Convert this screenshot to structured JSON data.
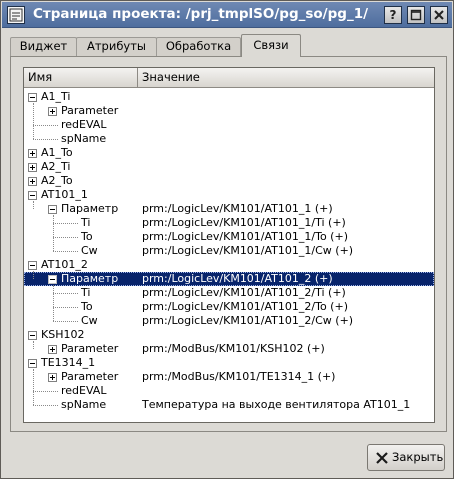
{
  "window": {
    "title": "Страница проекта: /prj_tmplSO/pg_so/pg_1/",
    "help_label": "?",
    "buttons": [
      "help-button",
      "maximize-button",
      "close-window-button"
    ]
  },
  "tabs": [
    {
      "label": "Виджет",
      "active": false
    },
    {
      "label": "Атрибуты",
      "active": false
    },
    {
      "label": "Обработка",
      "active": false
    },
    {
      "label": "Связи",
      "active": true
    }
  ],
  "tree": {
    "columns": [
      "Имя",
      "Значение"
    ],
    "rows": [
      {
        "name": "A1_Ti",
        "value": "",
        "level": 0,
        "expander": "minus"
      },
      {
        "name": "Parameter",
        "value": "",
        "level": 1,
        "expander": "plus"
      },
      {
        "name": "redEVAL",
        "value": "",
        "level": 1,
        "expander": ""
      },
      {
        "name": "spName",
        "value": "",
        "level": 1,
        "expander": ""
      },
      {
        "name": "A1_To",
        "value": "",
        "level": 0,
        "expander": "plus"
      },
      {
        "name": "A2_Ti",
        "value": "",
        "level": 0,
        "expander": "plus"
      },
      {
        "name": "A2_To",
        "value": "",
        "level": 0,
        "expander": "plus"
      },
      {
        "name": "AT101_1",
        "value": "",
        "level": 0,
        "expander": "minus"
      },
      {
        "name": "Параметр",
        "value": "prm:/LogicLev/KM101/AT101_1 (+)",
        "level": 1,
        "expander": "minus"
      },
      {
        "name": "Ti",
        "value": "prm:/LogicLev/KM101/AT101_1/Ti (+)",
        "level": 2,
        "expander": ""
      },
      {
        "name": "To",
        "value": "prm:/LogicLev/KM101/AT101_1/To (+)",
        "level": 2,
        "expander": ""
      },
      {
        "name": "Cw",
        "value": "prm:/LogicLev/KM101/AT101_1/Cw (+)",
        "level": 2,
        "expander": ""
      },
      {
        "name": "AT101_2",
        "value": "",
        "level": 0,
        "expander": "minus"
      },
      {
        "name": "Параметр",
        "value": "prm:/LogicLev/KM101/AT101_2 (+)",
        "level": 1,
        "expander": "minus",
        "selected": true
      },
      {
        "name": "Ti",
        "value": "prm:/LogicLev/KM101/AT101_2/Ti (+)",
        "level": 2,
        "expander": ""
      },
      {
        "name": "To",
        "value": "prm:/LogicLev/KM101/AT101_2/To (+)",
        "level": 2,
        "expander": ""
      },
      {
        "name": "Cw",
        "value": "prm:/LogicLev/KM101/AT101_2/Cw (+)",
        "level": 2,
        "expander": ""
      },
      {
        "name": "KSH102",
        "value": "",
        "level": 0,
        "expander": "minus"
      },
      {
        "name": "Parameter",
        "value": "prm:/ModBus/KM101/KSH102 (+)",
        "level": 1,
        "expander": "plus"
      },
      {
        "name": "TE1314_1",
        "value": "",
        "level": 0,
        "expander": "minus"
      },
      {
        "name": "Parameter",
        "value": "prm:/ModBus/KM101/TE1314_1 (+)",
        "level": 1,
        "expander": "plus"
      },
      {
        "name": "redEVAL",
        "value": "",
        "level": 1,
        "expander": ""
      },
      {
        "name": "spName",
        "value": "Температура на выходе вентилятора AT101_1",
        "level": 1,
        "expander": ""
      }
    ]
  },
  "footer": {
    "close_label": "Закрыть",
    "close_icon": "close-x-icon"
  },
  "colors": {
    "titlebar": "#5a77a6",
    "selection": "#08246b",
    "background": "#dcdad5"
  }
}
